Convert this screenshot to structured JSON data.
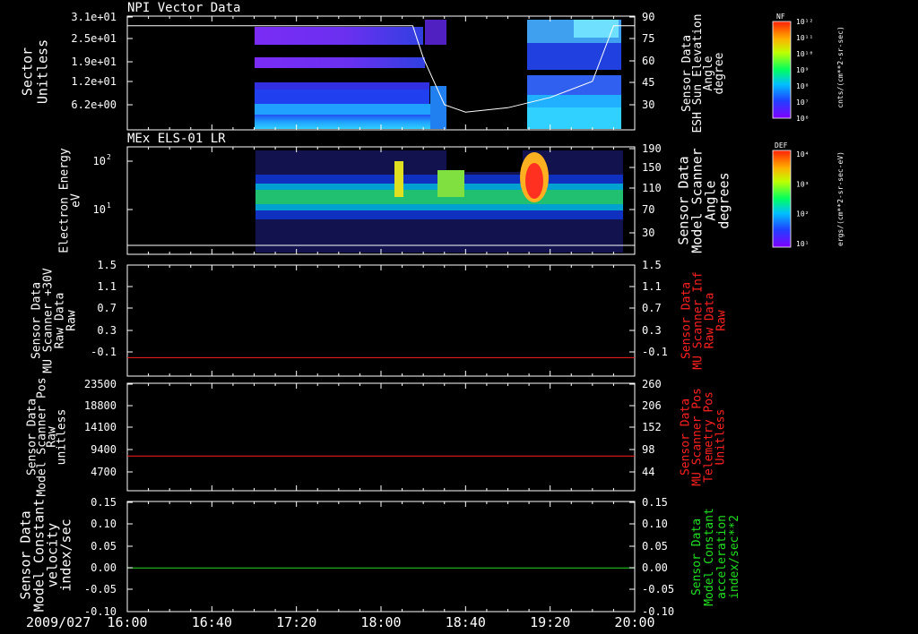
{
  "time_axis": {
    "labels": [
      "16:00",
      "16:40",
      "17:20",
      "18:00",
      "18:40",
      "19:20",
      "20:00"
    ],
    "date_label": "2009/027",
    "range_hours": [
      16.0,
      20.0
    ]
  },
  "panel1": {
    "title": "NPI Vector Data",
    "ylabel": [
      "Sector",
      "Unitless"
    ],
    "yticks": [
      "3.1e+01",
      "2.5e+01",
      "1.9e+01",
      "1.2e+01",
      "6.2e+00"
    ],
    "yticks_right": [
      "90",
      "75",
      "60",
      "45",
      "30"
    ],
    "ylabel_right": [
      "Sensor Data",
      "ESH Sun Elevation",
      "Angle",
      "degree"
    ],
    "colorbar_label": "NF",
    "colorbar_units": "cnts/(cm**2-sr-sec)",
    "colorbar_ticks": [
      "10¹²",
      "10¹¹",
      "10¹⁰",
      "10⁹",
      "10⁸",
      "10⁷",
      "10⁶"
    ]
  },
  "panel2": {
    "title": "MEx ELS-01 LR",
    "ylabel": [
      "Electron Energy",
      "eV"
    ],
    "yticks": [
      "10²",
      "10¹"
    ],
    "yticks_right": [
      "190",
      "150",
      "110",
      "70",
      "30"
    ],
    "ylabel_right": [
      "Sensor Data",
      "Model Scanner",
      "Angle",
      "degrees"
    ],
    "colorbar_label": "DEF",
    "colorbar_units": "ergs/(cm**2-sr-sec-eV)",
    "colorbar_ticks": [
      "10⁴",
      "10³",
      "10²",
      "10¹"
    ]
  },
  "panel3": {
    "ylabel": [
      "Sensor Data",
      "MU Scanner +30V",
      "Raw Data",
      "Raw"
    ],
    "yticks": [
      "1.5",
      "1.1",
      "0.7",
      "0.3",
      "-0.1"
    ],
    "yticks_right": [
      "1.5",
      "1.1",
      "0.7",
      "0.3",
      "-0.1"
    ],
    "ylabel_right": [
      "Sensor Data",
      "MU Scanner Inf",
      "Raw Data",
      "Raw"
    ]
  },
  "panel4": {
    "ylabel": [
      "Sensor Data",
      "Model Scanner Pos",
      "Raw",
      "unitless"
    ],
    "yticks": [
      "23500",
      "18800",
      "14100",
      "9400",
      "4700"
    ],
    "yticks_right": [
      "260",
      "206",
      "152",
      "98",
      "44"
    ],
    "ylabel_right": [
      "Sensor Data",
      "MU Scanner Pos",
      "Telemetry Pos",
      "Unitless"
    ]
  },
  "panel5": {
    "ylabel": [
      "Sensor Data",
      "Model Constant",
      "velocity",
      "index/sec"
    ],
    "yticks": [
      "0.15",
      "0.10",
      "0.05",
      "0.00",
      "-0.05",
      "-0.10"
    ],
    "yticks_right": [
      "0.15",
      "0.10",
      "0.05",
      "0.00",
      "-0.05",
      "-0.10"
    ],
    "ylabel_right": [
      "Sensor Data",
      "Model Constant",
      "acceleration",
      "index/sec**2"
    ]
  },
  "colors": {
    "red_series": "#ff2020",
    "green_series": "#20e020",
    "right_label_red": "#ff2020",
    "right_label_green": "#20e020"
  },
  "chart_data": [
    {
      "type": "heatmap",
      "title": "NPI Vector Data",
      "xlabel": "",
      "ylabel": "Sector Unitless",
      "x_range": [
        "16:00",
        "20:00"
      ],
      "data_gap": [
        "18:32",
        "19:15"
      ],
      "data_start": "17:00",
      "overlay_series": {
        "name": "Sensor Data ESH Sun Elevation Angle degree",
        "x": [
          "16:00",
          "17:00",
          "18:00",
          "18:15",
          "18:20",
          "18:30",
          "18:40",
          "19:00",
          "19:20",
          "19:40",
          "19:50",
          "20:00"
        ],
        "y": [
          84,
          84,
          84,
          84,
          62,
          30,
          25,
          28,
          35,
          46,
          84,
          84
        ]
      }
    },
    {
      "type": "heatmap",
      "title": "MEx ELS-01 LR",
      "xlabel": "",
      "ylabel": "Electron Energy eV",
      "x_range": [
        "16:00",
        "20:00"
      ],
      "data_start": "17:01",
      "data_end": "19:56",
      "overlay_series": {
        "name": "Sensor Data Model Scanner Angle degrees",
        "x": [
          "16:00",
          "20:00"
        ],
        "y": [
          15,
          15
        ]
      }
    },
    {
      "type": "line",
      "series": [
        {
          "name": "Sensor Data MU Scanner +30V Raw Data Raw",
          "x": [
            "16:00",
            "20:00"
          ],
          "y": [
            0.0,
            0.0
          ]
        }
      ],
      "ylim": [
        -0.3,
        1.5
      ]
    },
    {
      "type": "line",
      "series": [
        {
          "name": "Sensor Data Model Scanner Pos Raw unitless",
          "x": [
            "16:00",
            "20:00"
          ],
          "y": [
            7650,
            7650
          ]
        }
      ],
      "ylim": [
        0,
        23500
      ]
    },
    {
      "type": "line",
      "series": [
        {
          "name": "Sensor Data Model Constant velocity index/sec",
          "x": [
            "16:00",
            "20:00"
          ],
          "y": [
            0.0,
            0.0
          ]
        }
      ],
      "ylim": [
        -0.1,
        0.15
      ]
    }
  ]
}
